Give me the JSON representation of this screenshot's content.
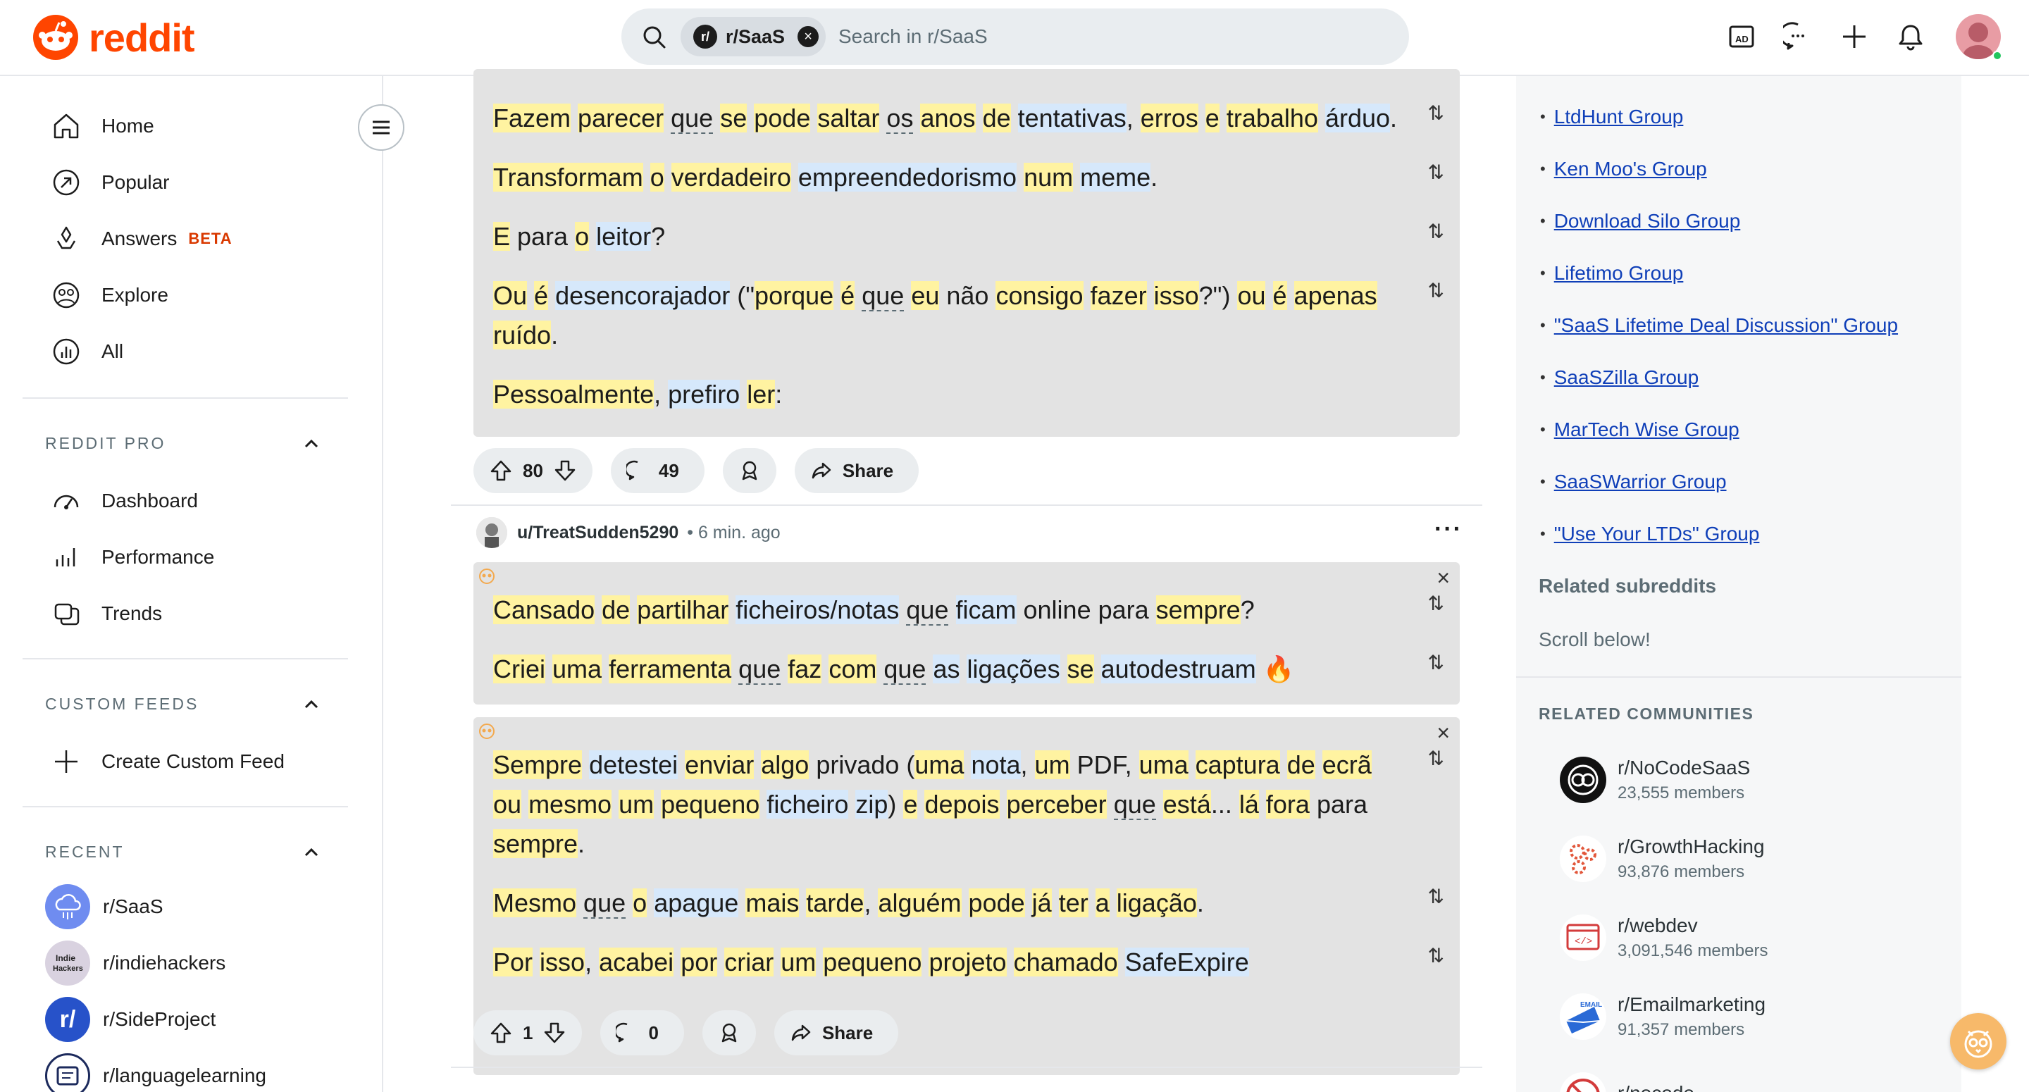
{
  "header": {
    "logo_text": "reddit",
    "search_chip": "r/SaaS",
    "search_placeholder": "Search in r/SaaS",
    "chip_icon_text": "r/"
  },
  "sidebar": {
    "nav": [
      {
        "label": "Home",
        "icon": "home-icon"
      },
      {
        "label": "Popular",
        "icon": "popular-icon"
      },
      {
        "label": "Answers",
        "icon": "answers-icon",
        "badge": "BETA"
      },
      {
        "label": "Explore",
        "icon": "explore-icon"
      },
      {
        "label": "All",
        "icon": "all-icon"
      }
    ],
    "pro_title": "REDDIT PRO",
    "pro_items": [
      {
        "label": "Dashboard",
        "icon": "dashboard-icon"
      },
      {
        "label": "Performance",
        "icon": "performance-icon"
      },
      {
        "label": "Trends",
        "icon": "trends-icon"
      }
    ],
    "custom_title": "CUSTOM FEEDS",
    "create_feed": "Create Custom Feed",
    "recent_title": "RECENT",
    "recent": [
      {
        "label": "r/SaaS"
      },
      {
        "label": "r/indiehackers"
      },
      {
        "label": "r/SideProject"
      },
      {
        "label": "r/languagelearning"
      }
    ]
  },
  "post1": {
    "lines": [
      [
        "Fazem",
        " ",
        "parecer",
        " ",
        "que",
        " ",
        "se",
        " ",
        "pode",
        " ",
        "saltar",
        " ",
        "os",
        " ",
        "anos",
        " ",
        "de",
        " ",
        "tentativas",
        ", ",
        "erros",
        " ",
        "e",
        " ",
        "trabalho",
        " ",
        "árduo",
        "."
      ],
      [
        "Transformam",
        " ",
        "o",
        " ",
        "verdadeiro",
        " ",
        "empreendedorismo",
        " ",
        "num",
        " ",
        "meme",
        "."
      ],
      [
        "E",
        " para ",
        "o",
        " ",
        "leitor",
        "?"
      ],
      [
        "Ou",
        " ",
        "é",
        " ",
        "desencorajador",
        " (\"",
        "porque",
        " ",
        "é",
        " ",
        "que",
        " ",
        "eu",
        " não ",
        "consigo",
        " ",
        "fazer",
        " ",
        "isso",
        "?\") ",
        "ou",
        " ",
        "é",
        " ",
        "apenas"
      ],
      [
        "ruído",
        "."
      ],
      [
        "Pessoalmente",
        ", ",
        "prefiro",
        " ",
        "ler",
        ":"
      ]
    ],
    "votes": "80",
    "comments": "49",
    "share": "Share"
  },
  "post2": {
    "author": "u/TreatSudden5290",
    "time": "6 min. ago",
    "block1": [
      [
        "Cansado",
        " ",
        "de",
        " ",
        "partilhar",
        " ",
        "ficheiros/notas",
        " ",
        "que",
        " ",
        "ficam",
        " online para ",
        "sempre",
        "?"
      ],
      [
        "Criei",
        " ",
        "uma",
        " ",
        "ferramenta",
        " ",
        "que",
        " ",
        "faz",
        " ",
        "com",
        " ",
        "que",
        " ",
        "as",
        " ",
        "ligações",
        " ",
        "se",
        " ",
        "autodestruam",
        " 🔥"
      ]
    ],
    "block2": [
      [
        "Sempre",
        " ",
        "detestei",
        " ",
        "enviar",
        " ",
        "algo",
        " privado (",
        "uma",
        " ",
        "nota",
        ", ",
        "um",
        " PDF, ",
        "uma",
        " ",
        "captura",
        " ",
        "de",
        " ",
        "ecrã"
      ],
      [
        "ou",
        " ",
        "mesmo",
        " ",
        "um",
        " ",
        "pequeno",
        " ",
        "ficheiro",
        " ",
        "zip",
        ") ",
        "e",
        " ",
        "depois",
        " ",
        "perceber",
        " ",
        "que",
        " ",
        "está",
        "... ",
        "lá",
        " ",
        "fora",
        " para"
      ],
      [
        "sempre",
        "."
      ],
      [
        "Mesmo",
        " ",
        "que",
        " ",
        "o",
        " ",
        "apague",
        " ",
        "mais",
        " ",
        "tarde",
        ", ",
        "alguém",
        " ",
        "pode",
        " ",
        "já",
        " ",
        "ter",
        " ",
        "a",
        " ",
        "ligação",
        "."
      ],
      [
        "Por",
        " ",
        "isso",
        ", ",
        "acabei",
        " ",
        "por",
        " ",
        "criar",
        " ",
        "um",
        " ",
        "pequeno",
        " ",
        "projeto",
        " ",
        "chamado",
        " ",
        "SafeExpire"
      ]
    ],
    "votes": "1",
    "comments": "0",
    "share": "Share"
  },
  "right": {
    "links": [
      "LtdHunt Group",
      "Ken Moo's Group",
      "Download Silo Group",
      "Lifetimo Group",
      "\"SaaS Lifetime Deal Discussion\" Group",
      "SaaSZilla Group",
      "MarTech Wise Group",
      "SaaSWarrior Group",
      "\"Use Your LTDs\" Group"
    ],
    "related_subs_title": "Related subreddits",
    "scroll_text": "Scroll below!",
    "related_comm_title": "RELATED COMMUNITIES",
    "communities": [
      {
        "name": "r/NoCodeSaaS",
        "members": "23,555 members"
      },
      {
        "name": "r/GrowthHacking",
        "members": "93,876 members"
      },
      {
        "name": "r/webdev",
        "members": "3,091,546 members"
      },
      {
        "name": "r/Emailmarketing",
        "members": "91,357 members"
      },
      {
        "name": "r/nocode",
        "members": ""
      }
    ]
  },
  "colors": {
    "brand": "#ff4500",
    "highlight_yellow": "#fff3a1",
    "highlight_blue": "#d6e8fb",
    "link": "#0f3fb8"
  }
}
